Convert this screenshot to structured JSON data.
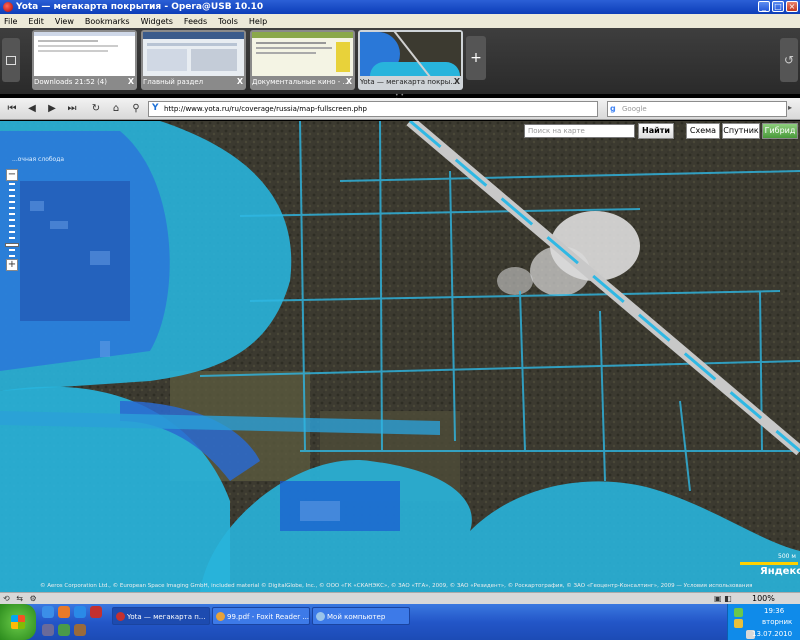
{
  "window": {
    "title": "Yota — мегакарта покрытия - Opera@USB 10.10"
  },
  "menu": [
    "File",
    "Edit",
    "View",
    "Bookmarks",
    "Widgets",
    "Feeds",
    "Tools",
    "Help"
  ],
  "tabs": [
    {
      "label": "Downloads 21:52 (4)",
      "close": "X"
    },
    {
      "label": "Главный раздел",
      "close": "X"
    },
    {
      "label": "Документальные кино - ...",
      "close": "X"
    },
    {
      "label": "Yota — мегакарта покры...",
      "close": "X"
    }
  ],
  "new_tab": "+",
  "address": "http://www.yota.ru/ru/coverage/russia/map-fullscreen.php",
  "search_placeholder": "Google",
  "map": {
    "search_placeholder": "Поиск на карте",
    "find_button": "Найти",
    "types": [
      "Схема",
      "Спутник",
      "Гибрид"
    ],
    "active_type": "Гибрид",
    "place_label": "...очная слобода",
    "copyright": "© Aeros Corporation Ltd., © European Space Imaging GmbH, included material © DigitalGlobe, Inc., © ООО «ГК «СКАНЭКС», © ЗАО «ТГА», 2009, © ЗАО «Резидент», © Роскартография, © ЗАО «Геоцентр-Консалтинг», 2009 — Условия использования",
    "scale": "500 м",
    "brand": "Яндекс"
  },
  "status": {
    "zoom": "100%"
  },
  "taskbar": {
    "items": [
      {
        "label": "Yota — мегакарта п...",
        "active": true
      },
      {
        "label": "99.pdf - Foxit Reader ...",
        "active": false
      },
      {
        "label": "Мой компьютер",
        "active": false
      }
    ],
    "clock": "19:36",
    "day": "вторник",
    "date": "13.07.2010"
  },
  "colors": {
    "coverage": "#28b4dc",
    "coverage_dark": "#1a5ad2",
    "forest": "#3c3a30",
    "road": "#c8c8c8",
    "active_maptype": "#4a9a3b"
  }
}
